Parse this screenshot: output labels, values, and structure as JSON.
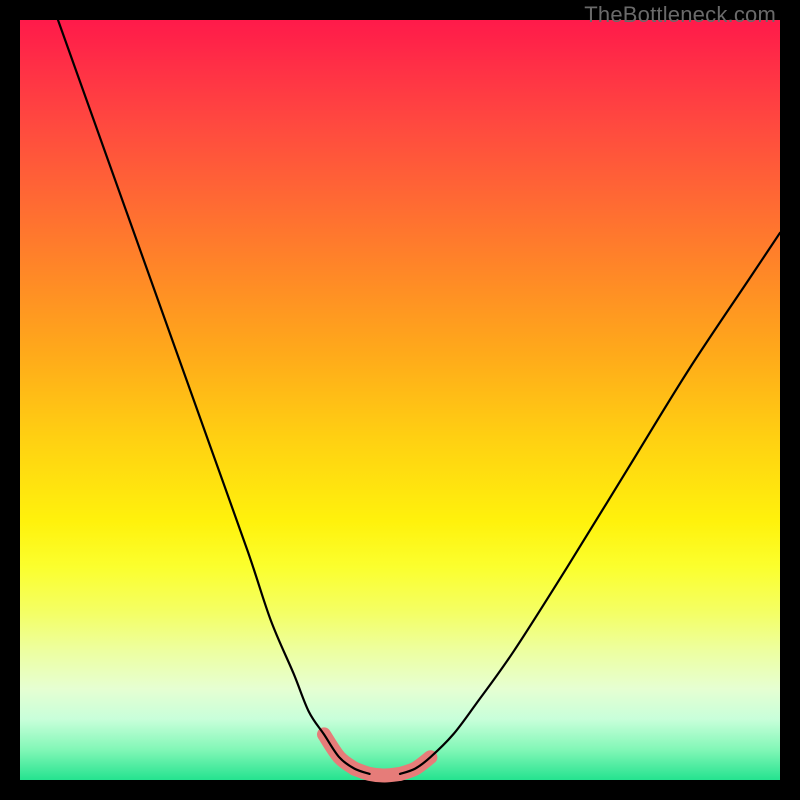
{
  "watermark": "TheBottleneck.com",
  "colors": {
    "frame": "#000000",
    "gradient_top": "#ff1a4a",
    "gradient_bottom": "#24e38f",
    "curve": "#000000",
    "highlight": "#e67c79"
  },
  "chart_data": {
    "type": "line",
    "title": "",
    "xlabel": "",
    "ylabel": "",
    "xlim": [
      0,
      100
    ],
    "ylim": [
      0,
      100
    ],
    "grid": false,
    "legend": false,
    "notes": "No axis ticks or numeric labels are shown; x and y are normalized 0–100 (x left→right, y value = 100 at top of colored area, 0 at bottom). Two black curves form a V shape meeting near the bottom. A short salmon segment overlays the valley.",
    "series": [
      {
        "name": "left-curve",
        "x": [
          5,
          10,
          15,
          20,
          25,
          30,
          33,
          36,
          38,
          40,
          42,
          44,
          46
        ],
        "y": [
          100,
          86,
          72,
          58,
          44,
          30,
          21,
          14,
          9,
          6,
          3,
          1.5,
          0.8
        ]
      },
      {
        "name": "right-curve",
        "x": [
          50,
          52,
          54,
          57,
          60,
          65,
          72,
          80,
          88,
          96,
          100
        ],
        "y": [
          0.8,
          1.5,
          3,
          6,
          10,
          17,
          28,
          41,
          54,
          66,
          72
        ]
      },
      {
        "name": "valley-highlight",
        "x": [
          40,
          42,
          44,
          46,
          48,
          50,
          52,
          54
        ],
        "y": [
          6,
          3,
          1.5,
          0.8,
          0.6,
          0.8,
          1.5,
          3
        ]
      }
    ]
  }
}
